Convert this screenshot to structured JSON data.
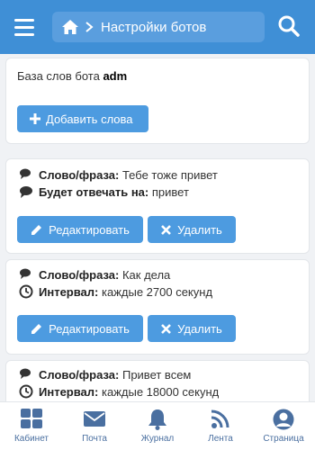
{
  "header": {
    "breadcrumb_label": "Настройки ботов"
  },
  "db": {
    "title_prefix": "База слов бота",
    "bot_name": "adm",
    "add_button": "Добавить слова"
  },
  "entries": [
    {
      "label1": "Слово/фраза:",
      "value1": "Тебе тоже привет",
      "label2": "Будет отвечать на:",
      "value2": "привет",
      "edit": "Редактировать",
      "delete": "Удалить"
    },
    {
      "label1": "Слово/фраза:",
      "value1": "Как дела",
      "label2": "Интервал:",
      "value2": "каждые 2700 секунд",
      "edit": "Редактировать",
      "delete": "Удалить"
    },
    {
      "label1": "Слово/фраза:",
      "value1": "Привет всем",
      "label2": "Интервал:",
      "value2": "каждые 18000 секунд"
    }
  ],
  "nav": [
    {
      "label": "Кабинет",
      "icon": "grid-icon"
    },
    {
      "label": "Почта",
      "icon": "mail-icon"
    },
    {
      "label": "Журнал",
      "icon": "bell-icon"
    },
    {
      "label": "Лента",
      "icon": "rss-icon"
    },
    {
      "label": "Страница",
      "icon": "user-icon"
    }
  ],
  "colors": {
    "accent": "#3f8fd6",
    "button": "#4d9be0",
    "nav_text": "#4a6fa0"
  }
}
